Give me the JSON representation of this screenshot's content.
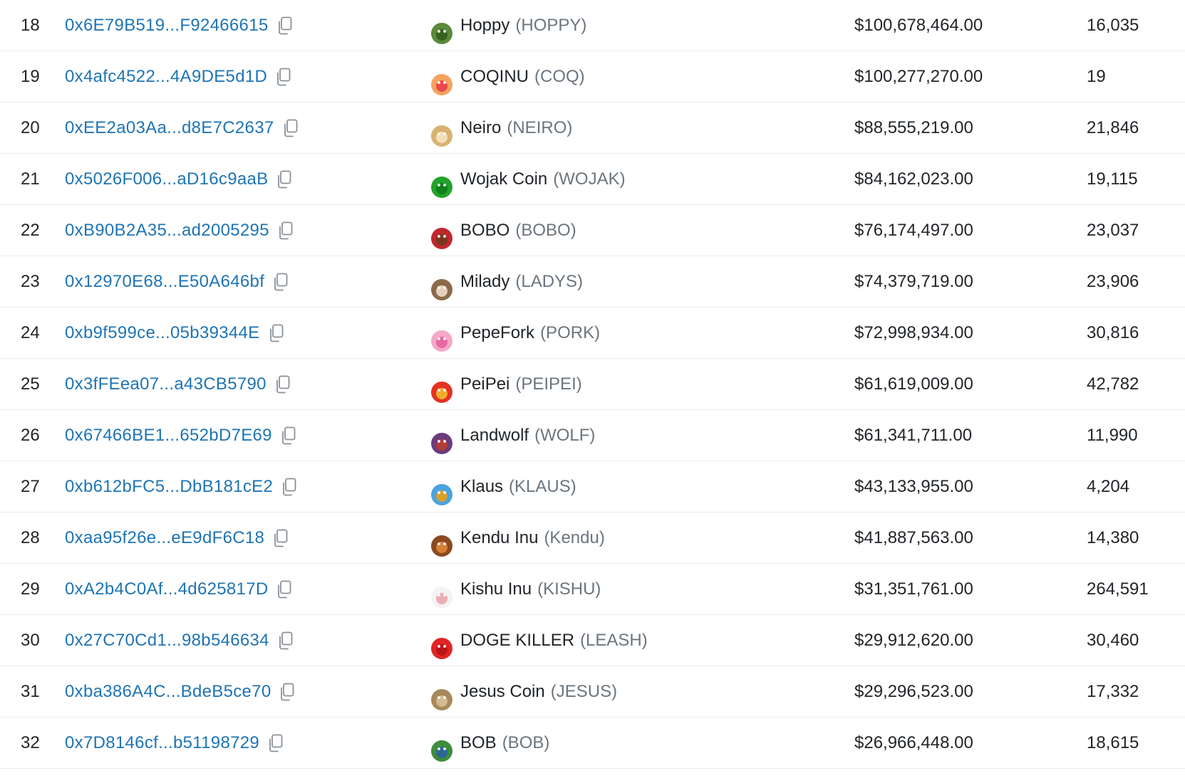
{
  "rows": [
    {
      "rank": "18",
      "address": "0x6E79B519...F92466615",
      "name": "Hoppy",
      "symbol": "(HOPPY)",
      "market_cap": "$100,678,464.00",
      "holders": "16,035",
      "logo_icon": "hoppy-logo-icon",
      "logo_colors": [
        "#5a8a3a",
        "#2f5a1e"
      ]
    },
    {
      "rank": "19",
      "address": "0x4afc4522...4A9DE5d1D",
      "name": "COQINU",
      "symbol": "(COQ)",
      "market_cap": "$100,277,270.00",
      "holders": "19",
      "logo_icon": "coqinu-logo-icon",
      "logo_colors": [
        "#f4a261",
        "#e63946"
      ]
    },
    {
      "rank": "20",
      "address": "0xEE2a03Aa...d8E7C2637",
      "name": "Neiro",
      "symbol": "(NEIRO)",
      "market_cap": "$88,555,219.00",
      "holders": "21,846",
      "logo_icon": "neiro-logo-icon",
      "logo_colors": [
        "#d9b26f",
        "#f5e6c8"
      ]
    },
    {
      "rank": "21",
      "address": "0x5026F006...aD16c9aaB",
      "name": "Wojak Coin",
      "symbol": "(WOJAK)",
      "market_cap": "$84,162,023.00",
      "holders": "19,115",
      "logo_icon": "wojak-logo-icon",
      "logo_colors": [
        "#22a32a",
        "#0d7a17"
      ]
    },
    {
      "rank": "22",
      "address": "0xB90B2A35...ad2005295",
      "name": "BOBO",
      "symbol": "(BOBO)",
      "market_cap": "$76,174,497.00",
      "holders": "23,037",
      "logo_icon": "bobo-logo-icon",
      "logo_colors": [
        "#c1272d",
        "#6b3a1e"
      ]
    },
    {
      "rank": "23",
      "address": "0x12970E68...E50A646bf",
      "name": "Milady",
      "symbol": "(LADYS)",
      "market_cap": "$74,379,719.00",
      "holders": "23,906",
      "logo_icon": "milady-logo-icon",
      "logo_colors": [
        "#8a6a4a",
        "#f2e2cf"
      ]
    },
    {
      "rank": "24",
      "address": "0xb9f599ce...05b39344E",
      "name": "PepeFork",
      "symbol": "(PORK)",
      "market_cap": "$72,998,934.00",
      "holders": "30,816",
      "logo_icon": "pepefork-logo-icon",
      "logo_colors": [
        "#f7a8c8",
        "#e35d9c"
      ]
    },
    {
      "rank": "25",
      "address": "0x3fFEea07...a43CB5790",
      "name": "PeiPei",
      "symbol": "(PEIPEI)",
      "market_cap": "$61,619,009.00",
      "holders": "42,782",
      "logo_icon": "peipei-logo-icon",
      "logo_colors": [
        "#e63222",
        "#f2c230"
      ]
    },
    {
      "rank": "26",
      "address": "0x67466BE1...652bD7E69",
      "name": "Landwolf",
      "symbol": "(WOLF)",
      "market_cap": "$61,341,711.00",
      "holders": "11,990",
      "logo_icon": "landwolf-logo-icon",
      "logo_colors": [
        "#6a3d7c",
        "#c0392b"
      ]
    },
    {
      "rank": "27",
      "address": "0xb612bFC5...DbB181cE2",
      "name": "Klaus",
      "symbol": "(KLAUS)",
      "market_cap": "$43,133,955.00",
      "holders": "4,204",
      "logo_icon": "klaus-logo-icon",
      "logo_colors": [
        "#4aa3df",
        "#f39c12"
      ]
    },
    {
      "rank": "28",
      "address": "0xaa95f26e...eE9dF6C18",
      "name": "Kendu Inu",
      "symbol": "(Kendu)",
      "market_cap": "$41,887,563.00",
      "holders": "14,380",
      "logo_icon": "kendu-logo-icon",
      "logo_colors": [
        "#8b4a1e",
        "#e08a3c"
      ]
    },
    {
      "rank": "29",
      "address": "0xA2b4C0Af...4d625817D",
      "name": "Kishu Inu",
      "symbol": "(KISHU)",
      "market_cap": "$31,351,761.00",
      "holders": "264,591",
      "logo_icon": "kishu-logo-icon",
      "logo_colors": [
        "#f3f3f3",
        "#e9a0a8"
      ]
    },
    {
      "rank": "30",
      "address": "0x27C70Cd1...98b546634",
      "name": "DOGE KILLER",
      "symbol": "(LEASH)",
      "market_cap": "$29,912,620.00",
      "holders": "30,460",
      "logo_icon": "leash-logo-icon",
      "logo_colors": [
        "#e02424",
        "#b31212"
      ]
    },
    {
      "rank": "31",
      "address": "0xba386A4C...BdeB5ce70",
      "name": "Jesus Coin",
      "symbol": "(JESUS)",
      "market_cap": "$29,296,523.00",
      "holders": "17,332",
      "logo_icon": "jesus-logo-icon",
      "logo_colors": [
        "#a88a5a",
        "#d9c39a"
      ]
    },
    {
      "rank": "32",
      "address": "0x7D8146cf...b51198729",
      "name": "BOB",
      "symbol": "(BOB)",
      "market_cap": "$26,966,448.00",
      "holders": "18,615",
      "logo_icon": "bob-logo-icon",
      "logo_colors": [
        "#3c8d3c",
        "#2b5ea8"
      ]
    }
  ],
  "colors": {
    "link": "#1e74b4",
    "text": "#212529",
    "muted": "#6c757d",
    "border": "#e9ecef",
    "copy_icon": "#8a9199"
  },
  "copy_icon": "copy-icon"
}
